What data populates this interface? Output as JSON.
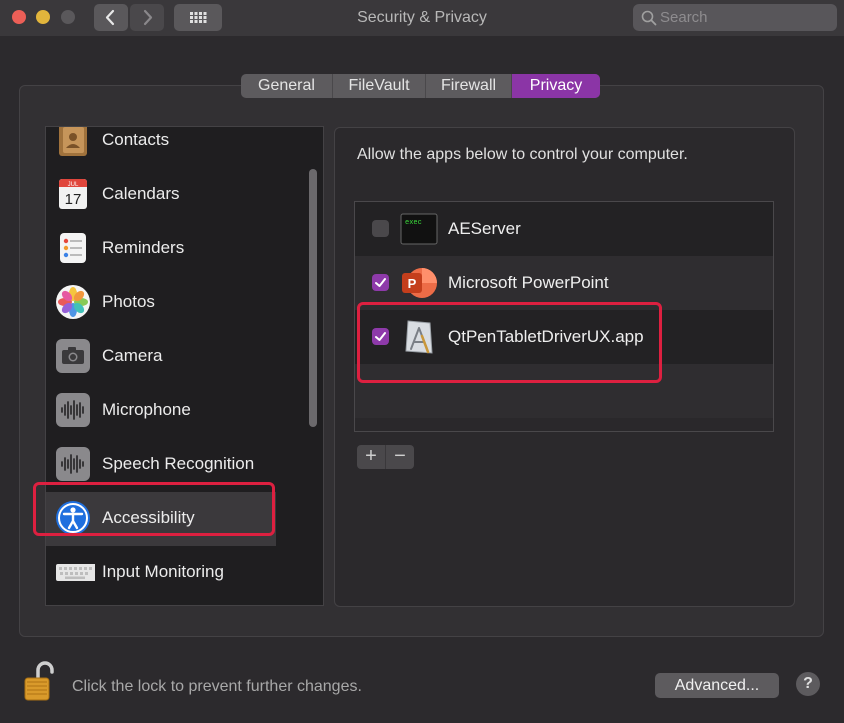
{
  "window": {
    "title": "Security & Privacy",
    "search_placeholder": "Search"
  },
  "tabs": [
    {
      "label": "General",
      "active": false
    },
    {
      "label": "FileVault",
      "active": false
    },
    {
      "label": "Firewall",
      "active": false
    },
    {
      "label": "Privacy",
      "active": true
    }
  ],
  "sidebar": {
    "items": [
      {
        "label": "Contacts",
        "icon": "contacts-icon"
      },
      {
        "label": "Calendars",
        "icon": "calendar-icon",
        "icon_month": "JUL",
        "icon_day": "17"
      },
      {
        "label": "Reminders",
        "icon": "reminders-icon"
      },
      {
        "label": "Photos",
        "icon": "photos-icon"
      },
      {
        "label": "Camera",
        "icon": "camera-icon"
      },
      {
        "label": "Microphone",
        "icon": "microphone-icon"
      },
      {
        "label": "Speech Recognition",
        "icon": "speech-recognition-icon"
      },
      {
        "label": "Accessibility",
        "icon": "accessibility-icon",
        "selected": true
      },
      {
        "label": "Input Monitoring",
        "icon": "keyboard-icon"
      }
    ]
  },
  "detail": {
    "instruction": "Allow the apps below to control your computer.",
    "apps": [
      {
        "name": "AEServer",
        "checked": false,
        "icon": "terminal-exec-icon",
        "icon_text": "exec"
      },
      {
        "name": "Microsoft PowerPoint",
        "checked": true,
        "icon": "powerpoint-icon",
        "icon_text": "P"
      },
      {
        "name": "QtPenTabletDriverUX.app",
        "checked": true,
        "icon": "app-generic-icon"
      }
    ],
    "add_label": "+",
    "remove_label": "−"
  },
  "footer": {
    "lock_text": "Click the lock to prevent further changes.",
    "advanced_label": "Advanced...",
    "help_label": "?"
  },
  "colors": {
    "accent": "#8e3aaa",
    "highlight": "#dd2040"
  }
}
